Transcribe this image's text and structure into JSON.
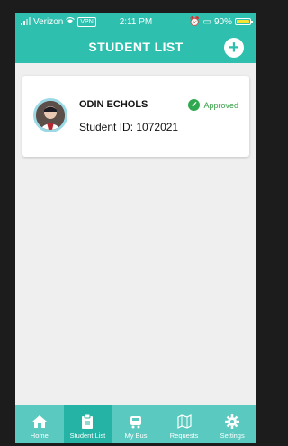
{
  "status_bar": {
    "carrier": "Verizon",
    "vpn": "VPN",
    "time": "2:11 PM",
    "battery": "90%",
    "battery_level": 0.9
  },
  "header": {
    "title": "STUDENT LIST",
    "add_icon": "plus-icon"
  },
  "students": [
    {
      "name": "ODIN ECHOLS",
      "student_id": "Student ID: 1072021",
      "status": "Approved",
      "status_color": "#3aa14b",
      "avatar_icon": "student-photo"
    }
  ],
  "tabs": [
    {
      "label": "Home",
      "icon": "home-icon",
      "active": false
    },
    {
      "label": "Student List",
      "icon": "clipboard-icon",
      "active": true
    },
    {
      "label": "My Bus",
      "icon": "bus-icon",
      "active": false
    },
    {
      "label": "Requests",
      "icon": "map-icon",
      "active": false
    },
    {
      "label": "Settings",
      "icon": "gear-icon",
      "active": false
    }
  ],
  "colors": {
    "primary": "#2ebfae",
    "tabbar": "#5ac9bf",
    "active_tab": "#24b3a4",
    "background": "#efeff0"
  }
}
